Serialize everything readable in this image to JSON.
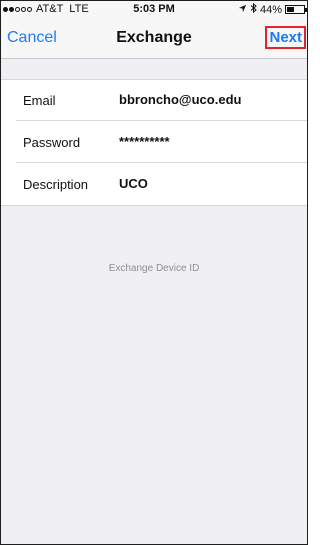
{
  "status_bar": {
    "signal_dots": [
      true,
      true,
      false,
      false,
      false
    ],
    "carrier": "AT&T",
    "network": "LTE",
    "time": "5:03 PM",
    "location_icon": "location-arrow-icon",
    "bluetooth_icon": "bluetooth-icon",
    "battery_percent": "44%",
    "battery_level": 0.44
  },
  "nav": {
    "cancel_label": "Cancel",
    "title": "Exchange",
    "next_label": "Next",
    "accent_color": "#1a7cf5",
    "highlight_color": "#e0262a"
  },
  "form": {
    "email": {
      "label": "Email",
      "value": "bbroncho@uco.edu"
    },
    "password": {
      "label": "Password",
      "value": "**********"
    },
    "description": {
      "label": "Description",
      "value": "UCO"
    }
  },
  "device_id_label": "Exchange Device ID"
}
